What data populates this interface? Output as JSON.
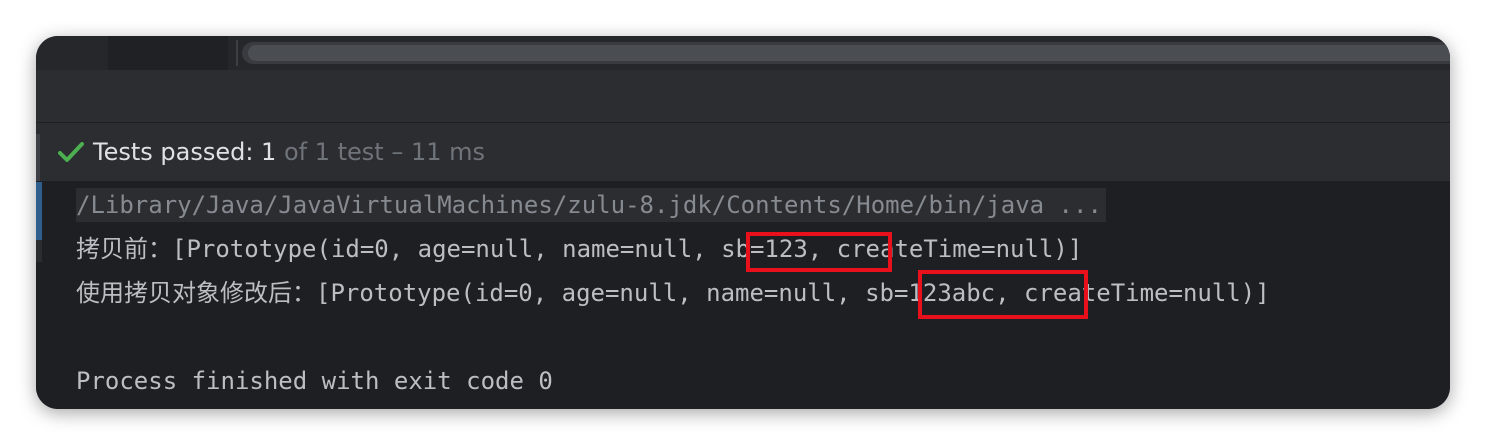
{
  "status": {
    "passed_label": "Tests passed: 1",
    "detail_label": " of 1 test – 11 ms"
  },
  "console": {
    "command": "/Library/Java/JavaVirtualMachines/zulu-8.jdk/Contents/Home/bin/java ...",
    "line_before": "拷贝前：[Prototype(id=0, age=null, name=null, sb=123, createTime=null)]",
    "line_after": "使用拷贝对象修改后：[Prototype(id=0, age=null, name=null, sb=123abc, createTime=null)]",
    "exit": "Process finished with exit code 0"
  },
  "colors": {
    "success": "#4caf50",
    "highlight_box": "#e8101a"
  },
  "icons": {
    "status": "check-icon"
  }
}
